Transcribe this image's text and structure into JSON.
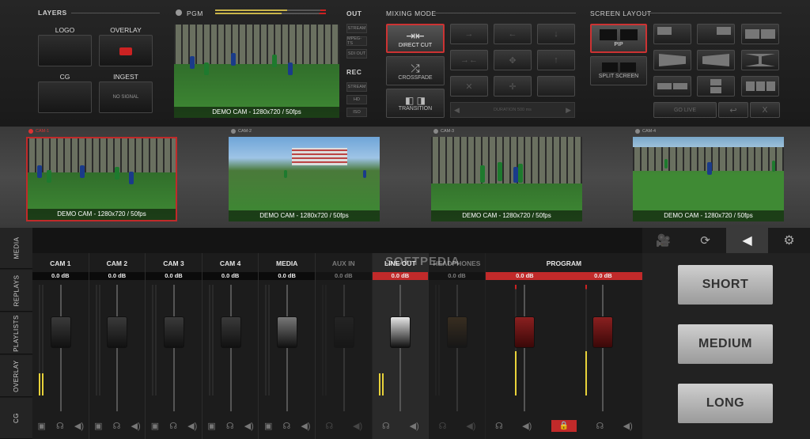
{
  "layers": {
    "title": "LAYERS",
    "items": [
      {
        "label": "LOGO",
        "content": ""
      },
      {
        "label": "OVERLAY",
        "content": ""
      },
      {
        "label": "CG",
        "content": ""
      },
      {
        "label": "INGEST",
        "content": "NO SIGNAL"
      }
    ]
  },
  "pgm": {
    "label": "PGM",
    "caption": "DEMO CAM - 1280x720 / 50fps",
    "out_title": "OUT",
    "out_buttons": [
      "STREAM",
      "MPEG-TS",
      "SDI OUT"
    ],
    "rec_title": "REC",
    "rec_buttons": [
      "STREAM",
      "HD",
      "ISO"
    ]
  },
  "mixing": {
    "title": "MIXING MODE",
    "direct_cut": "DIRECT CUT",
    "crossfade": "CROSSFADE",
    "transition": "TRANSITION",
    "duration": "DURATION 500 ms"
  },
  "screen_layout": {
    "title": "SCREEN LAYOUT",
    "pip": "PIP",
    "split": "SPLIT SCREEN",
    "go_live": "GO LIVE",
    "close": "X"
  },
  "cams": [
    {
      "label": "CAM-1",
      "caption": "DEMO CAM - 1280x720 / 50fps",
      "active": true
    },
    {
      "label": "CAM-2",
      "caption": "DEMO CAM - 1280x720 / 50fps",
      "active": false
    },
    {
      "label": "CAM-3",
      "caption": "DEMO CAM - 1280x720 / 50fps",
      "active": false
    },
    {
      "label": "CAM-4",
      "caption": "DEMO CAM - 1280x720 / 50fps",
      "active": false
    }
  ],
  "side_tabs": [
    "MEDIA",
    "REPLAYS",
    "PLAYLISTS",
    "OVERLAY",
    "CG"
  ],
  "channels": [
    {
      "name": "CAM 1",
      "db": "0.0 dB"
    },
    {
      "name": "CAM 2",
      "db": "0.0 dB"
    },
    {
      "name": "CAM 3",
      "db": "0.0 dB"
    },
    {
      "name": "CAM 4",
      "db": "0.0 dB"
    },
    {
      "name": "MEDIA",
      "db": "0.0 dB"
    },
    {
      "name": "AUX IN",
      "db": "0.0 dB"
    },
    {
      "name": "LINE OUT",
      "db": "0.0 dB"
    },
    {
      "name": "HEADPHONES",
      "db": "0.0 dB"
    }
  ],
  "program": {
    "name": "PROGRAM",
    "db_left": "0.0 dB",
    "db_right": "0.0 dB"
  },
  "watermark": "SOFTPEDIA",
  "replay_buttons": [
    "SHORT",
    "MEDIUM",
    "LONG"
  ],
  "colors": {
    "accent_red": "#c12a2a",
    "meter_yellow": "#e8d23a"
  }
}
